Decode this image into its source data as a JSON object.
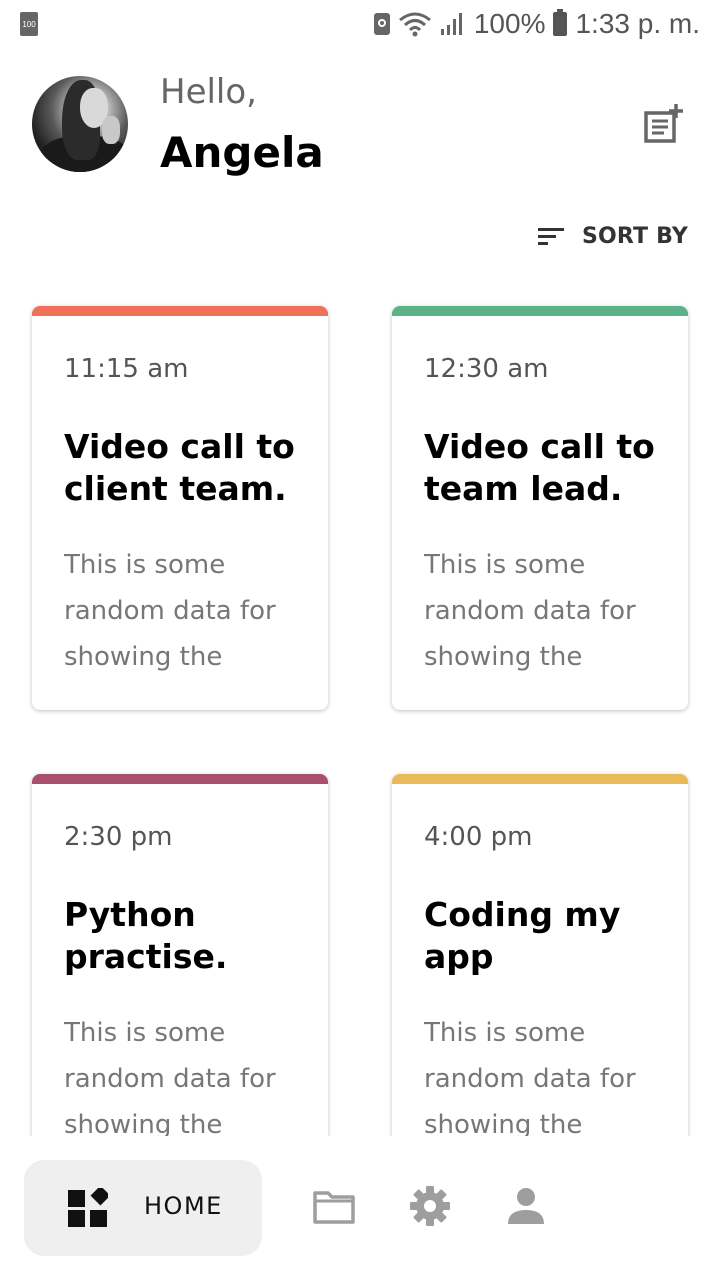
{
  "status_bar": {
    "left_battery_badge": "100",
    "battery_percent": "100%",
    "time": "1:33 p. m."
  },
  "header": {
    "greeting": "Hello,",
    "user_name": "Angela"
  },
  "sort": {
    "label": "SORT BY"
  },
  "cards": [
    {
      "time": "11:15 am",
      "title": "Video call to client team.",
      "description": "This is some random data for showing the",
      "color": "#F0705A"
    },
    {
      "time": "12:30 am",
      "title": "Video call to team lead.",
      "description": "This is some random data for showing the",
      "color": "#5BB286"
    },
    {
      "time": "2:30 pm",
      "title": "Python practise.",
      "description": "This is some random data for showing the",
      "color": "#A9506F"
    },
    {
      "time": "4:00 pm",
      "title": "Coding my app",
      "description": "This is some random data for showing the",
      "color": "#E9B95A"
    }
  ],
  "bottom_nav": {
    "home_label": "HOME",
    "icons": [
      "dashboard-icon",
      "folder-icon",
      "settings-icon",
      "person-icon"
    ]
  },
  "colors": {
    "icon_gray": "#9e9e9e",
    "nav_active_bg": "#efefef"
  }
}
